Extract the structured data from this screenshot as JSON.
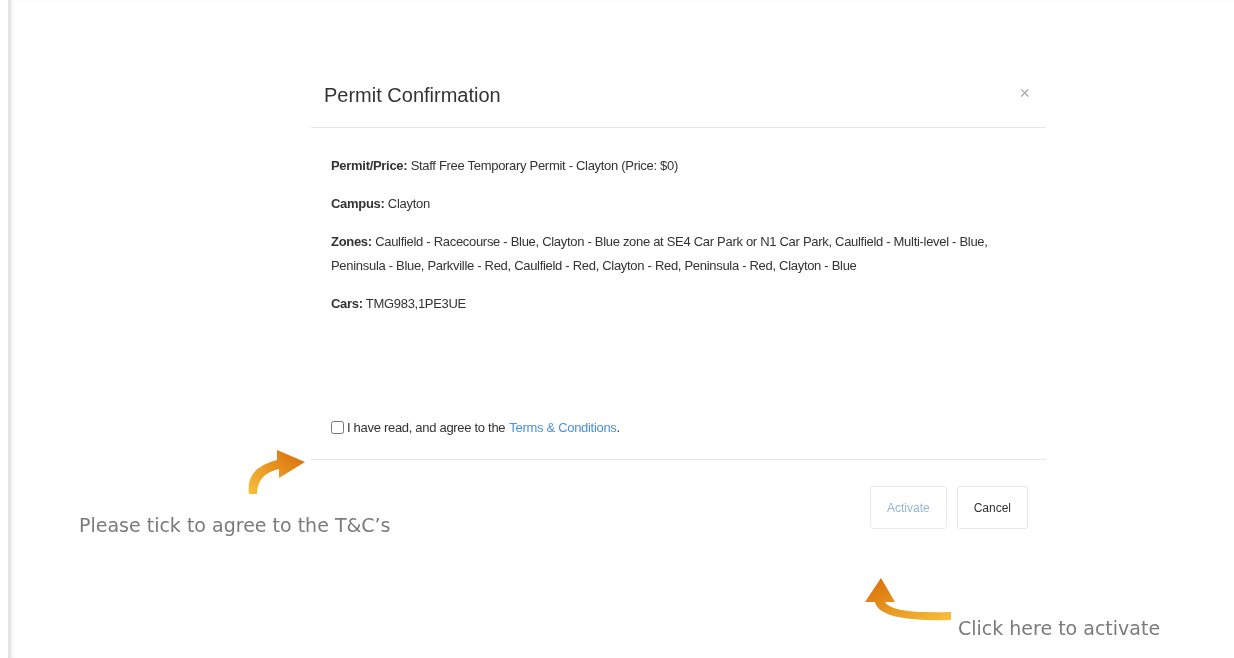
{
  "dialog": {
    "title": "Permit Confirmation",
    "close": "×",
    "details": [
      {
        "label": "Permit/Price:",
        "value": "Staff Free Temporary Permit - Clayton (Price: $0)"
      },
      {
        "label": "Campus:",
        "value": "Clayton"
      },
      {
        "label": "Zones:",
        "value": "Caulfield - Racecourse - Blue, Clayton - Blue zone at SE4 Car Park or N1 Car Park, Caulfield - Multi-level - Blue, Peninsula - Blue, Parkville - Red, Caulfield - Red, Clayton - Red, Peninsula - Red, Clayton - Blue"
      },
      {
        "label": "Cars:",
        "value": "TMG983,1PE3UE"
      }
    ],
    "agreement": {
      "checked": false,
      "text": "I have read, and agree to the",
      "link": "Terms & Conditions",
      "end": "."
    },
    "buttons": [
      {
        "label": "Activate",
        "disabled": true
      },
      {
        "label": "Cancel",
        "disabled": false
      }
    ]
  },
  "annotations": [
    {
      "text": "Please tick to agree to the T&C’s"
    },
    {
      "text": "Click here to activate"
    }
  ]
}
